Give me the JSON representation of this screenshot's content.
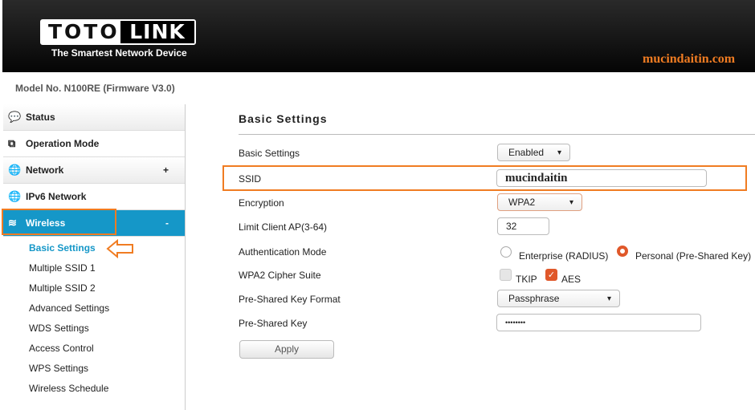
{
  "header": {
    "logo_left": "TOTO",
    "logo_right": "LINK",
    "tagline": "The Smartest Network Device",
    "watermark": "mucindaitin.com"
  },
  "model": "Model No. N100RE (Firmware V3.0)",
  "sidebar": {
    "items": [
      {
        "label": "Status",
        "icon": "status-icon",
        "toggle": ""
      },
      {
        "label": "Operation Mode",
        "icon": "operation-mode-icon",
        "toggle": ""
      },
      {
        "label": "Network",
        "icon": "globe-icon",
        "toggle": "+"
      },
      {
        "label": "IPv6 Network",
        "icon": "globe-icon",
        "toggle": ""
      },
      {
        "label": "Wireless",
        "icon": "wifi-icon",
        "toggle": "-"
      }
    ],
    "subitems": [
      "Basic Settings",
      "Multiple SSID 1",
      "Multiple SSID 2",
      "Advanced Settings",
      "WDS Settings",
      "Access Control",
      "WPS Settings",
      "Wireless Schedule"
    ]
  },
  "main": {
    "title": "Basic Settings",
    "labels": {
      "basic": "Basic Settings",
      "ssid": "SSID",
      "encryption": "Encryption",
      "limit": "Limit Client AP(3-64)",
      "auth": "Authentication Mode",
      "cipher": "WPA2 Cipher Suite",
      "pskformat": "Pre-Shared Key Format",
      "psk": "Pre-Shared Key"
    },
    "values": {
      "basic": "Enabled",
      "ssid": "mucindaitin",
      "encryption": "WPA2",
      "limit": "32",
      "pskformat": "Passphrase",
      "psk": "••••••••"
    },
    "auth_options": [
      "Enterprise (RADIUS)",
      "Personal (Pre-Shared Key)"
    ],
    "auth_selected": "Personal (Pre-Shared Key)",
    "cipher_options": [
      {
        "label": "TKIP",
        "checked": false
      },
      {
        "label": "AES",
        "checked": true
      }
    ],
    "apply": "Apply"
  },
  "colors": {
    "accent": "#1597c8",
    "highlight": "#f07c22",
    "radio": "#e0582a"
  }
}
